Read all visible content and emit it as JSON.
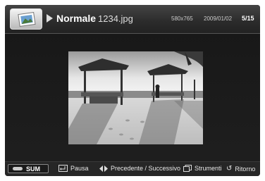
{
  "header": {
    "mode_label": "Normale",
    "filename": "1234.jpg",
    "resolution": "580x765",
    "date": "2009/01/02",
    "position": "5/15",
    "app_icon": "photo-frame-icon",
    "play_icon": "play-icon"
  },
  "photo": {
    "description_icon": "beach-photo"
  },
  "bottom": {
    "sum_label": "SUM",
    "pause_label": "Pausa",
    "prev_next_label": "Precedente / Successivo",
    "tools_label": "Strumenti",
    "return_label": "Ritorno"
  },
  "colors": {
    "background": "#1c1c1c",
    "text": "#ffffff"
  }
}
